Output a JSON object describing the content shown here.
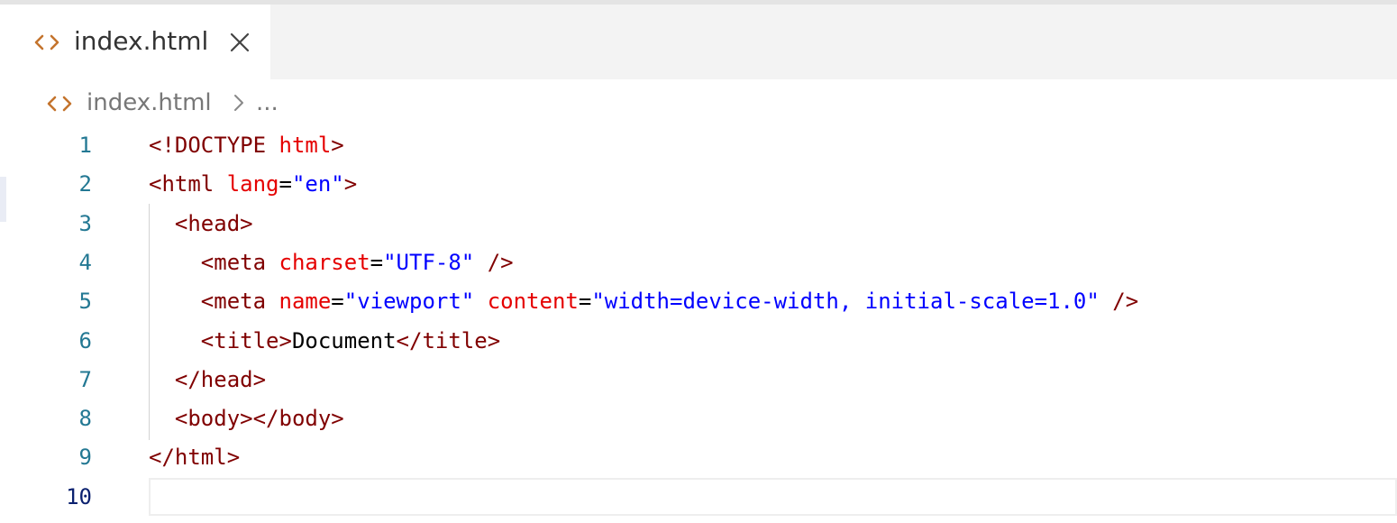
{
  "tab": {
    "label": "index.html",
    "icon": "html-file-icon",
    "close_icon": "close-icon"
  },
  "breadcrumb": {
    "file": "index.html",
    "separator": "chevron-right-icon",
    "more": "..."
  },
  "colors": {
    "file_icon": "#c4742d",
    "tag": "#800000",
    "attribute": "#e50000",
    "string": "#0000ff",
    "line_number": "#237893",
    "active_line_number": "#0b216f"
  },
  "editor": {
    "active_line": 10,
    "lines": [
      {
        "number": "1",
        "tokens": [
          {
            "type": "tag",
            "text": "<!DOCTYPE "
          },
          {
            "type": "attr",
            "text": "html"
          },
          {
            "type": "tag",
            "text": ">"
          }
        ]
      },
      {
        "number": "2",
        "tokens": [
          {
            "type": "tag",
            "text": "<html "
          },
          {
            "type": "attr",
            "text": "lang"
          },
          {
            "type": "text",
            "text": "="
          },
          {
            "type": "str",
            "text": "\"en\""
          },
          {
            "type": "tag",
            "text": ">"
          }
        ]
      },
      {
        "number": "3",
        "tokens": [
          {
            "type": "text",
            "text": "  "
          },
          {
            "type": "tag",
            "text": "<head>"
          }
        ]
      },
      {
        "number": "4",
        "tokens": [
          {
            "type": "text",
            "text": "    "
          },
          {
            "type": "tag",
            "text": "<meta "
          },
          {
            "type": "attr",
            "text": "charset"
          },
          {
            "type": "text",
            "text": "="
          },
          {
            "type": "str",
            "text": "\"UTF-8\""
          },
          {
            "type": "text",
            "text": " "
          },
          {
            "type": "tag",
            "text": "/>"
          }
        ]
      },
      {
        "number": "5",
        "tokens": [
          {
            "type": "text",
            "text": "    "
          },
          {
            "type": "tag",
            "text": "<meta "
          },
          {
            "type": "attr",
            "text": "name"
          },
          {
            "type": "text",
            "text": "="
          },
          {
            "type": "str",
            "text": "\"viewport\""
          },
          {
            "type": "text",
            "text": " "
          },
          {
            "type": "attr",
            "text": "content"
          },
          {
            "type": "text",
            "text": "="
          },
          {
            "type": "str",
            "text": "\"width=device-width, initial-scale=1.0\""
          },
          {
            "type": "text",
            "text": " "
          },
          {
            "type": "tag",
            "text": "/>"
          }
        ]
      },
      {
        "number": "6",
        "tokens": [
          {
            "type": "text",
            "text": "    "
          },
          {
            "type": "tag",
            "text": "<title>"
          },
          {
            "type": "text",
            "text": "Document"
          },
          {
            "type": "tag",
            "text": "</title>"
          }
        ]
      },
      {
        "number": "7",
        "tokens": [
          {
            "type": "text",
            "text": "  "
          },
          {
            "type": "tag",
            "text": "</head>"
          }
        ]
      },
      {
        "number": "8",
        "tokens": [
          {
            "type": "text",
            "text": "  "
          },
          {
            "type": "tag",
            "text": "<body></body>"
          }
        ]
      },
      {
        "number": "9",
        "tokens": [
          {
            "type": "tag",
            "text": "</html>"
          }
        ]
      },
      {
        "number": "10",
        "tokens": []
      }
    ]
  }
}
